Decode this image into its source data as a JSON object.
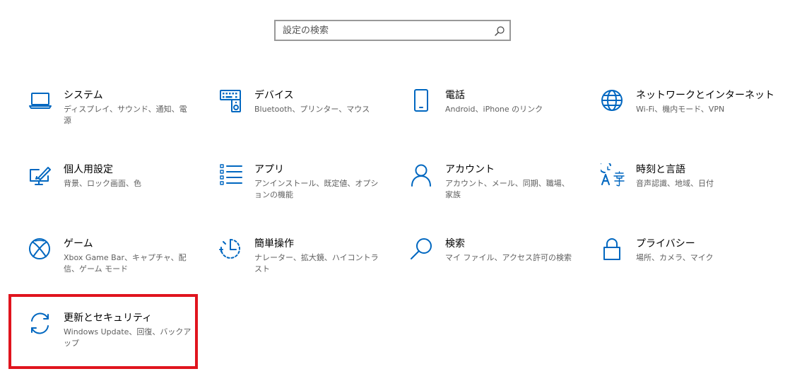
{
  "search": {
    "placeholder": "設定の検索",
    "value": ""
  },
  "tiles": [
    {
      "title": "システム",
      "desc": "ディスプレイ、サウンド、通知、電源",
      "icon": "laptop-icon"
    },
    {
      "title": "デバイス",
      "desc": "Bluetooth、プリンター、マウス",
      "icon": "keyboard-speaker-icon"
    },
    {
      "title": "電話",
      "desc": "Android、iPhone のリンク",
      "icon": "phone-icon"
    },
    {
      "title": "ネットワークとインターネット",
      "desc": "Wi-Fi、機内モード、VPN",
      "icon": "globe-icon"
    },
    {
      "title": "個人用設定",
      "desc": "背景、ロック画面、色",
      "icon": "paintbrush-monitor-icon"
    },
    {
      "title": "アプリ",
      "desc": "アンインストール、既定値、オプションの機能",
      "icon": "app-list-icon"
    },
    {
      "title": "アカウント",
      "desc": "アカウント、メール、同期、職場、家族",
      "icon": "person-icon"
    },
    {
      "title": "時刻と言語",
      "desc": "音声認識、地域、日付",
      "icon": "time-language-icon"
    },
    {
      "title": "ゲーム",
      "desc": "Xbox Game Bar、キャプチャ、配信、ゲーム モード",
      "icon": "xbox-icon"
    },
    {
      "title": "簡単操作",
      "desc": "ナレーター、拡大鏡、ハイコントラスト",
      "icon": "ease-of-access-icon"
    },
    {
      "title": "検索",
      "desc": "マイ ファイル、アクセス許可の検索",
      "icon": "search-magnifier-icon"
    },
    {
      "title": "プライバシー",
      "desc": "場所、カメラ、マイク",
      "icon": "lock-icon"
    },
    {
      "title": "更新とセキュリティ",
      "desc": "Windows Update、回復、バックアップ",
      "icon": "sync-arrows-icon"
    }
  ],
  "colors": {
    "accent": "#0067c0",
    "highlight": "#e0141e",
    "search_border": "#999999"
  }
}
